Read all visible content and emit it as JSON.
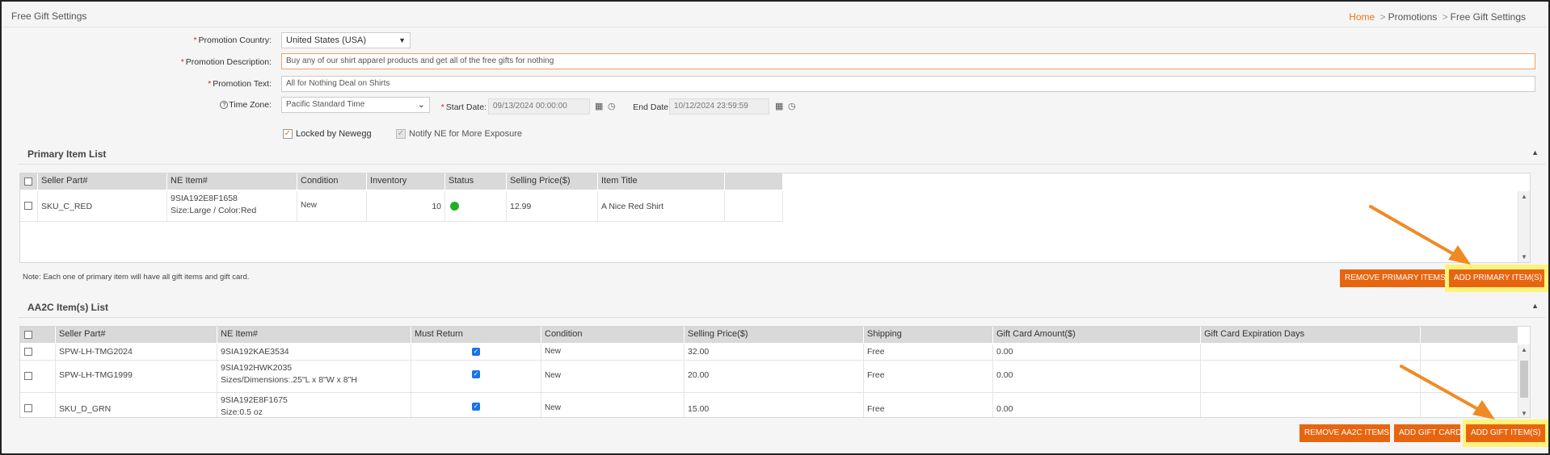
{
  "header": {
    "title": "Free Gift Settings",
    "breadcrumb": {
      "home": "Home",
      "sep": ">",
      "promotions": "Promotions",
      "current": "Free Gift Settings"
    }
  },
  "form": {
    "country_label": "Promotion Country:",
    "country_value": "United States (USA)",
    "description_label": "Promotion Description:",
    "description_value": "Buy any of our shirt apparel products and get all of the free gifts for nothing",
    "text_label": "Promotion Text:",
    "text_value": "All for Nothing Deal on Shirts",
    "timezone_label": "Time Zone:",
    "timezone_value": "Pacific Standard Time",
    "start_label": "Start Date:",
    "start_value": "09/13/2024 00:00:00",
    "end_label": "End Date:",
    "end_value": "10/12/2024 23:59:59",
    "locked_label": "Locked by Newegg",
    "locked_checked": true,
    "notify_label": "Notify NE for More Exposure",
    "notify_checked": true,
    "required_mark": "*",
    "info_mark": "?"
  },
  "primary": {
    "title": "Primary Item List",
    "columns": [
      "Seller Part#",
      "NE Item#",
      "Condition",
      "Inventory",
      "Status",
      "Selling Price($)",
      "Item Title"
    ],
    "rows": [
      {
        "seller_part": "SKU_C_RED",
        "ne_item": "9SIA192E8F1658",
        "ne_item_sub": "Size:Large / Color:Red",
        "condition": "New",
        "inventory": "10",
        "status": "active",
        "price": "12.99",
        "title": "A Nice Red Shirt"
      }
    ],
    "note": "Note: Each one of primary item will have all gift items and gift card.",
    "remove_button": "REMOVE PRIMARY ITEMS",
    "add_button": "ADD PRIMARY ITEM(S)"
  },
  "aa2c": {
    "title": "AA2C Item(s) List",
    "columns": [
      "Seller Part#",
      "NE Item#",
      "Must Return",
      "Condition",
      "Selling Price($)",
      "Shipping",
      "Gift Card Amount($)",
      "Gift Card Expiration Days"
    ],
    "rows": [
      {
        "seller_part": "SPW-LH-TMG2024",
        "ne_item": "9SIA192KAE3534",
        "ne_item_sub": "",
        "must_return": true,
        "condition": "New",
        "price": "32.00",
        "shipping": "Free",
        "gift_card_amount": "0.00",
        "gift_card_days": ""
      },
      {
        "seller_part": "SPW-LH-TMG1999",
        "ne_item": "9SIA192HWK2035",
        "ne_item_sub": "Sizes/Dimensions:.25\"L x 8\"W x 8\"H",
        "must_return": true,
        "condition": "New",
        "price": "20.00",
        "shipping": "Free",
        "gift_card_amount": "0.00",
        "gift_card_days": ""
      },
      {
        "seller_part": "SKU_D_GRN",
        "ne_item": "9SIA192E8F1675",
        "ne_item_sub": "Size:0.5 oz",
        "must_return": true,
        "condition": "New",
        "price": "15.00",
        "shipping": "Free",
        "gift_card_amount": "0.00",
        "gift_card_days": ""
      }
    ],
    "remove_button": "REMOVE AA2C ITEMS",
    "gift_card_button": "ADD GIFT CARD",
    "add_button": "ADD GIFT ITEM(S)"
  },
  "colors": {
    "accent": "#e8650f",
    "highlight": "#fff37a",
    "arrow": "#f08a24",
    "status_active": "#20b020"
  },
  "icons": {
    "calendar": "calendar-icon",
    "clock": "clock-icon",
    "collapse": "chevron-up-icon"
  }
}
